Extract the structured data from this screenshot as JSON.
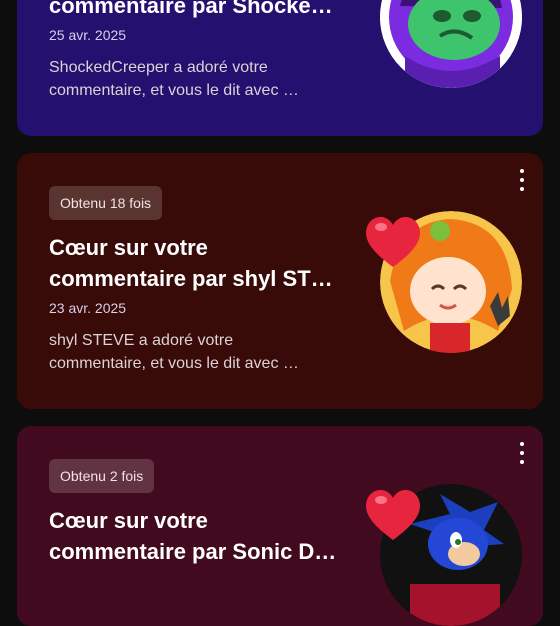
{
  "notifications": [
    {
      "title": "commentaire par Shocke…",
      "date": "25 avr. 2025",
      "desc_line1": "ShockedCreeper a adoré votre",
      "desc_line2": "commentaire, et vous le dit avec …",
      "avatar_icon": "creeper-avatar-icon"
    },
    {
      "badge": "Obtenu 18 fois",
      "title_line1": "Cœur sur votre",
      "title_line2": "commentaire par shyl ST…",
      "date": "23 avr. 2025",
      "desc_line1": "shyl STEVE a adoré votre",
      "desc_line2": "commentaire, et vous le dit avec …",
      "avatar_icon": "orange-character-avatar-icon"
    },
    {
      "badge": "Obtenu 2 fois",
      "title_line1": "Cœur sur votre",
      "title_line2": "commentaire par Sonic D…",
      "avatar_icon": "sonic-avatar-icon"
    }
  ],
  "colors": {
    "card1": "#24106f",
    "card2": "#380b08",
    "card3": "#420a1e",
    "heart": "#e8253f"
  }
}
